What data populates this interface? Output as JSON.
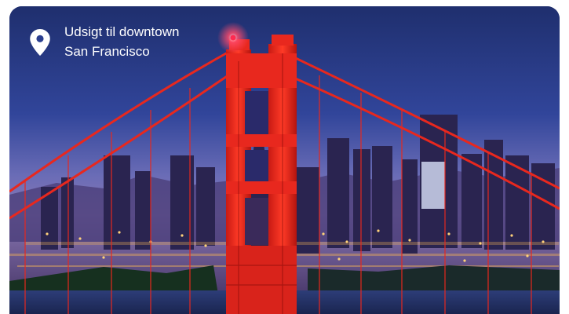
{
  "location": {
    "icon": "map-pin-icon",
    "line1": "Udsigt til downtown",
    "line2": "San Francisco"
  },
  "colors": {
    "sky_top": "#1f2f6e",
    "sky_mid": "#3a4a9e",
    "horizon": "#7a6fb8",
    "bridge": "#e8281e",
    "city_lights": "#f3b457"
  }
}
